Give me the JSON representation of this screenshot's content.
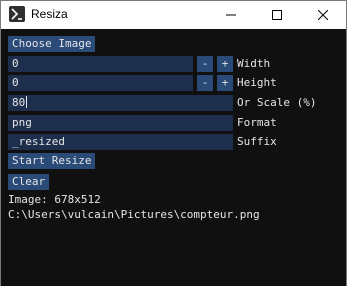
{
  "window": {
    "title": "Resiza"
  },
  "controls": {
    "choose_image": "Choose Image",
    "width": {
      "value": "0",
      "label": "Width",
      "decrement": "-",
      "increment": "+"
    },
    "height": {
      "value": "0",
      "label": "Height",
      "decrement": "-",
      "increment": "+"
    },
    "scale": {
      "value": "80",
      "label": "Or Scale (%)"
    },
    "format": {
      "value": "png",
      "label": "Format"
    },
    "suffix": {
      "value": "_resized",
      "label": "Suffix"
    },
    "start_resize": "Start Resize",
    "clear": "Clear"
  },
  "info": {
    "image_size": "Image: 678x512",
    "image_path": "C:\\Users\\vulcain\\Pictures\\compteur.png"
  },
  "colors": {
    "background": "#101010",
    "button": "#2a4a78",
    "field": "#1d2f4d",
    "text": "#e6e6e6"
  }
}
